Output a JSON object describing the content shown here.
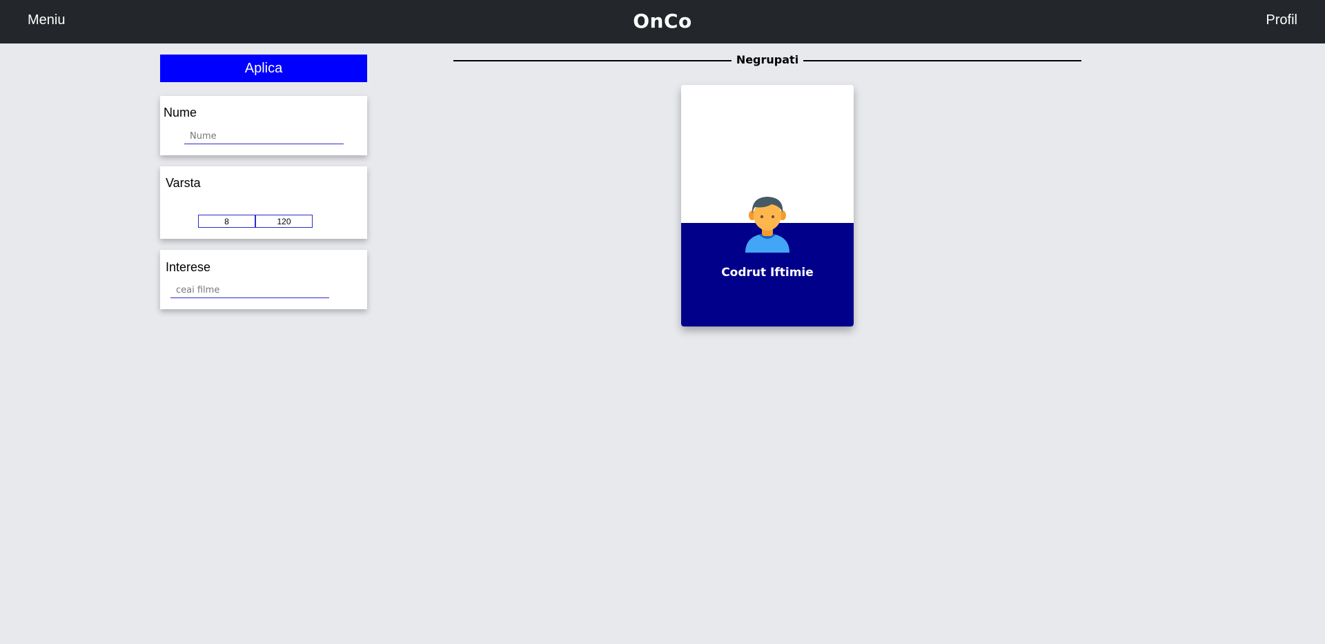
{
  "navbar": {
    "menu_label": "Meniu",
    "brand": "OnCo",
    "profile_label": "Profil"
  },
  "filters": {
    "apply_label": "Aplica",
    "name": {
      "label": "Nume",
      "placeholder": "Nume",
      "value": ""
    },
    "age": {
      "label": "Varsta",
      "min": "8",
      "max": "120"
    },
    "interests": {
      "label": "Interese",
      "placeholder": "ceai filme",
      "value": ""
    }
  },
  "group": {
    "title": "Negrupati",
    "people": [
      {
        "name": "Codrut Iftimie",
        "avatar_icon": "user-avatar-icon"
      }
    ]
  },
  "colors": {
    "navbar_bg": "#23272b",
    "page_bg": "#e8e9ed",
    "apply_button": "#0000ff",
    "card_bottom": "#00008b",
    "input_border": "#2a2ad0"
  }
}
